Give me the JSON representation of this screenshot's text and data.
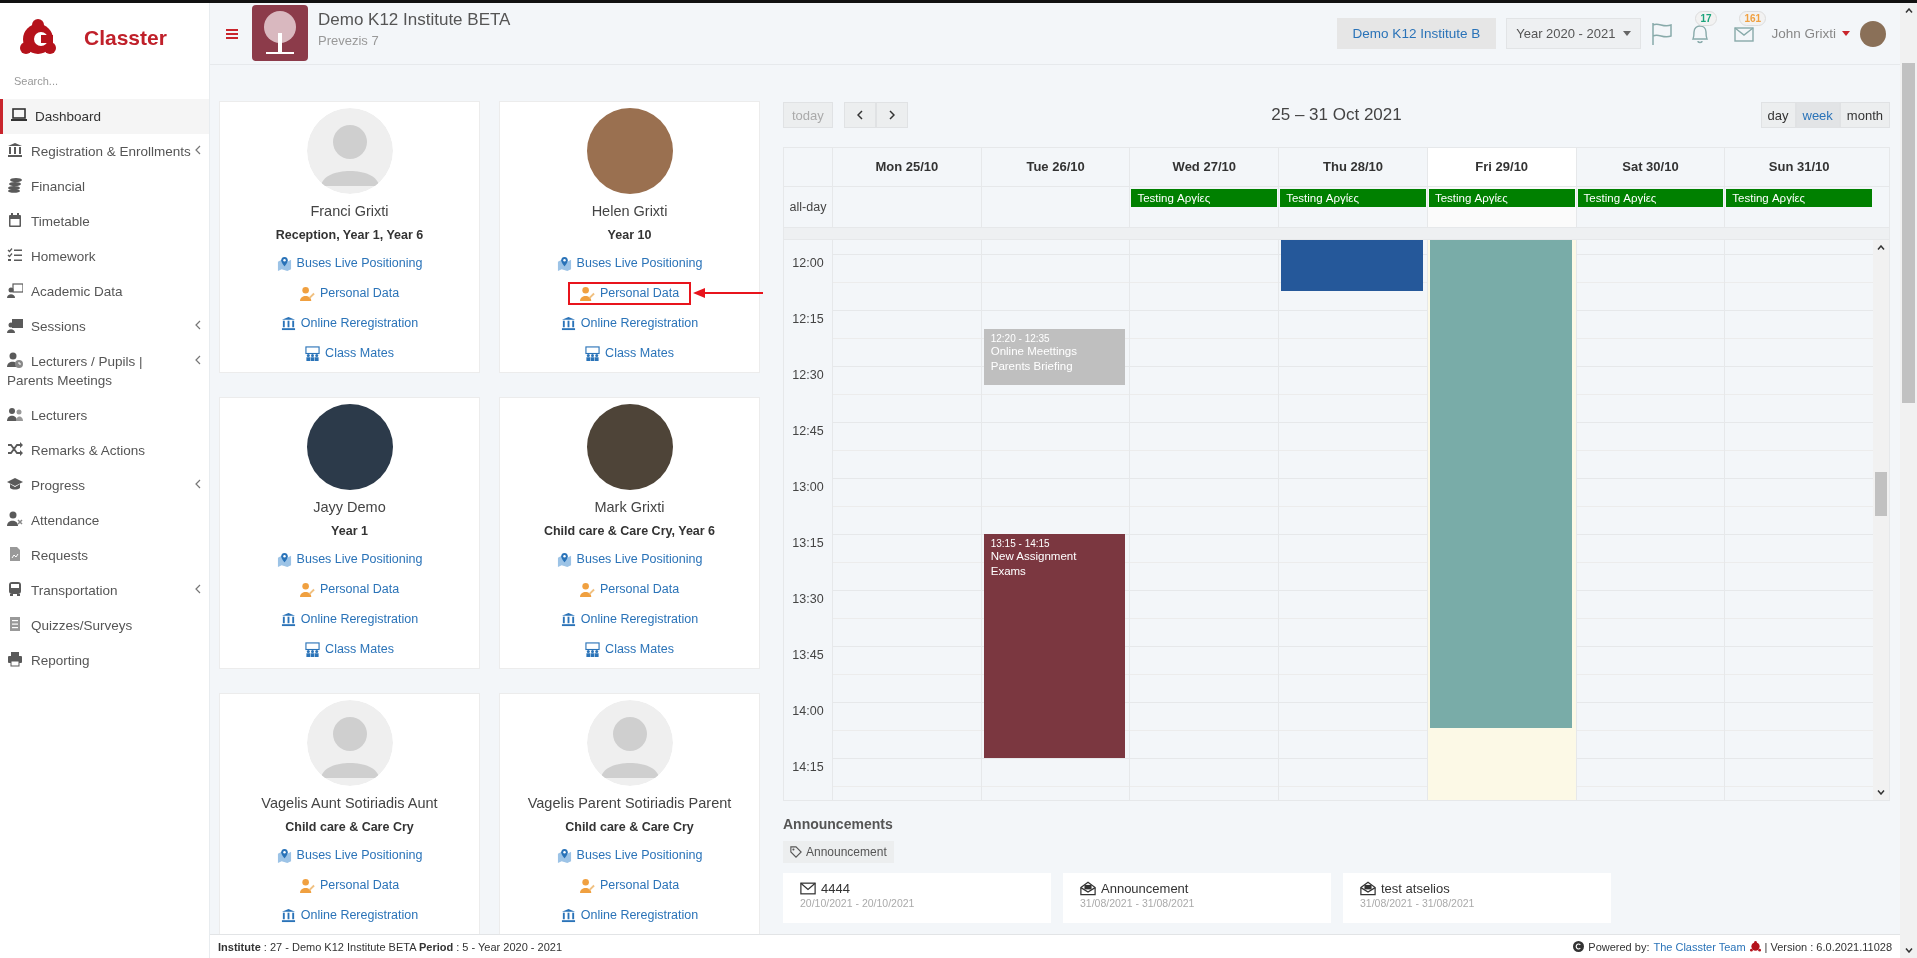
{
  "sidebar": {
    "brand": "Classter",
    "search": {
      "placeholder": "Search..."
    },
    "items": [
      {
        "label": "Dashboard",
        "selected": true,
        "expandable": false
      },
      {
        "label": "Registration & Enrollments",
        "selected": false,
        "expandable": true
      },
      {
        "label": "Financial",
        "selected": false,
        "expandable": false
      },
      {
        "label": "Timetable",
        "selected": false,
        "expandable": false
      },
      {
        "label": "Homework",
        "selected": false,
        "expandable": false
      },
      {
        "label": "Academic Data",
        "selected": false,
        "expandable": false
      },
      {
        "label": "Sessions",
        "selected": false,
        "expandable": true
      },
      {
        "label": "Lecturers / Pupils | Parents Meetings",
        "selected": false,
        "expandable": true
      },
      {
        "label": "Lecturers",
        "selected": false,
        "expandable": false
      },
      {
        "label": "Remarks & Actions",
        "selected": false,
        "expandable": false
      },
      {
        "label": "Progress",
        "selected": false,
        "expandable": true
      },
      {
        "label": "Attendance",
        "selected": false,
        "expandable": false
      },
      {
        "label": "Requests",
        "selected": false,
        "expandable": false
      },
      {
        "label": "Transportation",
        "selected": false,
        "expandable": true
      },
      {
        "label": "Quizzes/Surveys",
        "selected": false,
        "expandable": false
      },
      {
        "label": "Reporting",
        "selected": false,
        "expandable": false
      }
    ]
  },
  "topbar": {
    "institute": {
      "title": "Demo K12 Institute BETA",
      "subtitle": "Prevezis 7"
    },
    "institute_button": "Demo K12 Institute B",
    "year_select": "Year 2020 - 2021",
    "notifications": "17",
    "messages": "161",
    "user": "John Grixti"
  },
  "persons": [
    {
      "name": "Franci Grixti",
      "classes": "Reception, Year 1, Year 6",
      "has_photo": false,
      "links": [
        {
          "kind": "bus",
          "label": "Buses Live Positioning",
          "highlighted": false
        },
        {
          "kind": "personal",
          "label": "Personal Data",
          "highlighted": false
        },
        {
          "kind": "registration",
          "label": "Online Reregistration",
          "highlighted": false
        },
        {
          "kind": "classmates",
          "label": "Class Mates",
          "highlighted": false
        }
      ]
    },
    {
      "name": "Helen Grixti",
      "classes": "Year 10",
      "has_photo": true,
      "links": [
        {
          "kind": "bus",
          "label": "Buses Live Positioning",
          "highlighted": false
        },
        {
          "kind": "personal",
          "label": "Personal Data",
          "highlighted": true
        },
        {
          "kind": "registration",
          "label": "Online Reregistration",
          "highlighted": false
        },
        {
          "kind": "classmates",
          "label": "Class Mates",
          "highlighted": false
        }
      ]
    },
    {
      "name": "Jayy Demo",
      "classes": "Year 1",
      "has_photo": true,
      "links": [
        {
          "kind": "bus",
          "label": "Buses Live Positioning",
          "highlighted": false
        },
        {
          "kind": "personal",
          "label": "Personal Data",
          "highlighted": false
        },
        {
          "kind": "registration",
          "label": "Online Reregistration",
          "highlighted": false
        },
        {
          "kind": "classmates",
          "label": "Class Mates",
          "highlighted": false
        }
      ]
    },
    {
      "name": "Mark Grixti",
      "classes": "Child care & Care Cry, Year 6",
      "has_photo": true,
      "links": [
        {
          "kind": "bus",
          "label": "Buses Live Positioning",
          "highlighted": false
        },
        {
          "kind": "personal",
          "label": "Personal Data",
          "highlighted": false
        },
        {
          "kind": "registration",
          "label": "Online Reregistration",
          "highlighted": false
        },
        {
          "kind": "classmates",
          "label": "Class Mates",
          "highlighted": false
        }
      ]
    },
    {
      "name": "Vagelis Aunt Sotiriadis Aunt",
      "classes": "Child care & Care Cry",
      "has_photo": false,
      "links": [
        {
          "kind": "bus",
          "label": "Buses Live Positioning",
          "highlighted": false
        },
        {
          "kind": "personal",
          "label": "Personal Data",
          "highlighted": false
        },
        {
          "kind": "registration",
          "label": "Online Reregistration",
          "highlighted": false
        }
      ]
    },
    {
      "name": "Vagelis Parent Sotiriadis Parent",
      "classes": "Child care & Care Cry",
      "has_photo": false,
      "links": [
        {
          "kind": "bus",
          "label": "Buses Live Positioning",
          "highlighted": false
        },
        {
          "kind": "personal",
          "label": "Personal Data",
          "highlighted": false
        },
        {
          "kind": "registration",
          "label": "Online Reregistration",
          "highlighted": false
        }
      ]
    }
  ],
  "calendar": {
    "today_button": {
      "label": "today",
      "disabled": true
    },
    "title": "25 – 31 Oct 2021",
    "views": [
      {
        "label": "day",
        "selected": false
      },
      {
        "label": "week",
        "selected": true
      },
      {
        "label": "month",
        "selected": false
      }
    ],
    "allday_label": "all-day",
    "times": [
      "12:00",
      "12:15",
      "12:30",
      "12:45",
      "13:00",
      "13:15",
      "13:30",
      "13:45",
      "14:00",
      "14:15"
    ],
    "days": [
      {
        "label": "Mon 25/10",
        "today": false
      },
      {
        "label": "Tue 26/10",
        "today": false,
        "events": [
          {
            "time": "12:20 - 12:35",
            "lines": [
              "Online Meettings",
              "Parents Briefing"
            ],
            "color": "#bfbfbf"
          },
          {
            "time": "13:15 - 14:15",
            "lines": [
              "New Assignment",
              "Exams"
            ],
            "color": "#7b3740"
          }
        ]
      },
      {
        "label": "Wed 27/10",
        "today": false,
        "allday_events": [
          {
            "title": "Testing Αργίες",
            "color": "#008000"
          }
        ]
      },
      {
        "label": "Thu 28/10",
        "today": false,
        "allday_events": [
          {
            "title": "Testing Αργίες",
            "color": "#008000"
          }
        ],
        "events": [
          {
            "color": "#25589a"
          }
        ]
      },
      {
        "label": "Fri 29/10",
        "today": true,
        "allday_events": [
          {
            "title": "Testing Αργίες",
            "color": "#008000"
          }
        ],
        "events": [
          {
            "color": "#79aca8"
          }
        ]
      },
      {
        "label": "Sat 30/10",
        "today": false,
        "allday_events": [
          {
            "title": "Testing Αργίες",
            "color": "#008000"
          }
        ]
      },
      {
        "label": "Sun 31/10",
        "today": false,
        "allday_events": [
          {
            "title": "Testing Αργίες",
            "color": "#008000"
          }
        ]
      }
    ]
  },
  "announcements": {
    "title": "Announcements",
    "filter": "Announcement",
    "items": [
      {
        "title": "4444",
        "dates": "20/10/2021 - 20/10/2021",
        "read": false
      },
      {
        "title": "Announcement",
        "dates": "31/08/2021 - 31/08/2021",
        "read": true
      },
      {
        "title": "test atselios",
        "dates": "31/08/2021 - 31/08/2021",
        "read": true
      }
    ]
  },
  "status_bar": {
    "info": "**Institute** : 27 - Demo K12 Institute BETA **Period** : 5 - Year 2020 - 2021",
    "powered_by": "Powered by:",
    "team_link": "The Classter Team",
    "version": "| Version : 6.0.2021.11028"
  }
}
